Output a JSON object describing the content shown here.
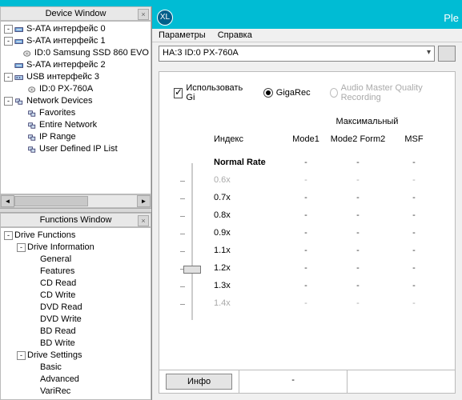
{
  "app": {
    "logo_text": "XL",
    "title_frag": "Ple"
  },
  "menu": {
    "params": "Параметры",
    "help": "Справка"
  },
  "device_select": "HA:3 ID:0  PX-760A",
  "panels": {
    "device_title": "Device Window",
    "functions_title": "Functions Window"
  },
  "device_tree": [
    {
      "lvl": 1,
      "exp": "-",
      "icon": "sata",
      "label": "S-ATA интерфейс 0"
    },
    {
      "lvl": 1,
      "exp": "-",
      "icon": "sata",
      "label": "S-ATA интерфейс 1"
    },
    {
      "lvl": 2,
      "exp": "",
      "icon": "disk",
      "label": "ID:0  Samsung SSD 860 EVO"
    },
    {
      "lvl": 1,
      "exp": "",
      "icon": "sata",
      "label": "S-ATA интерфейс 2"
    },
    {
      "lvl": 1,
      "exp": "-",
      "icon": "usb",
      "label": "USB интерфейс 3"
    },
    {
      "lvl": 2,
      "exp": "",
      "icon": "disk",
      "label": "ID:0  PX-760A"
    },
    {
      "lvl": 1,
      "exp": "-",
      "icon": "net",
      "label": "Network Devices"
    },
    {
      "lvl": 2,
      "exp": "",
      "icon": "net",
      "label": "Favorites"
    },
    {
      "lvl": 2,
      "exp": "",
      "icon": "net",
      "label": "Entire Network"
    },
    {
      "lvl": 2,
      "exp": "",
      "icon": "net",
      "label": "IP Range"
    },
    {
      "lvl": 2,
      "exp": "",
      "icon": "net",
      "label": "User Defined IP List"
    }
  ],
  "functions_tree": [
    {
      "lvl": 1,
      "exp": "-",
      "label": "Drive Functions"
    },
    {
      "lvl": 2,
      "exp": "-",
      "label": "Drive Information"
    },
    {
      "lvl": 3,
      "exp": "",
      "label": "General"
    },
    {
      "lvl": 3,
      "exp": "",
      "label": "Features"
    },
    {
      "lvl": 3,
      "exp": "",
      "label": "CD Read"
    },
    {
      "lvl": 3,
      "exp": "",
      "label": "CD Write"
    },
    {
      "lvl": 3,
      "exp": "",
      "label": "DVD Read"
    },
    {
      "lvl": 3,
      "exp": "",
      "label": "DVD Write"
    },
    {
      "lvl": 3,
      "exp": "",
      "label": "BD Read"
    },
    {
      "lvl": 3,
      "exp": "",
      "label": "BD Write"
    },
    {
      "lvl": 2,
      "exp": "-",
      "label": "Drive Settings"
    },
    {
      "lvl": 3,
      "exp": "",
      "label": "Basic"
    },
    {
      "lvl": 3,
      "exp": "",
      "label": "Advanced"
    },
    {
      "lvl": 3,
      "exp": "",
      "label": "VariRec"
    }
  ],
  "options": {
    "use_gigarec": "Использовать Gi",
    "gigarec": "GigaRec",
    "amqr": "Audio Master Quality Recording"
  },
  "labels": {
    "max": "Максимальный",
    "index": "Индекс",
    "mode1": "Mode1",
    "mode2form2": "Mode2 Form2",
    "msf": "MSF",
    "normal_rate": "Normal Rate",
    "info_btn": "Инфо",
    "status_dash": "-"
  },
  "rates": [
    {
      "label": "0.6x",
      "dim": true
    },
    {
      "label": "0.7x",
      "dim": false
    },
    {
      "label": "0.8x",
      "dim": false
    },
    {
      "label": "0.9x",
      "dim": false
    },
    {
      "label": "1.1x",
      "dim": false
    },
    {
      "label": "1.2x",
      "dim": false
    },
    {
      "label": "1.3x",
      "dim": false
    },
    {
      "label": "1.4x",
      "dim": true
    }
  ],
  "slider_selected_index": 5
}
